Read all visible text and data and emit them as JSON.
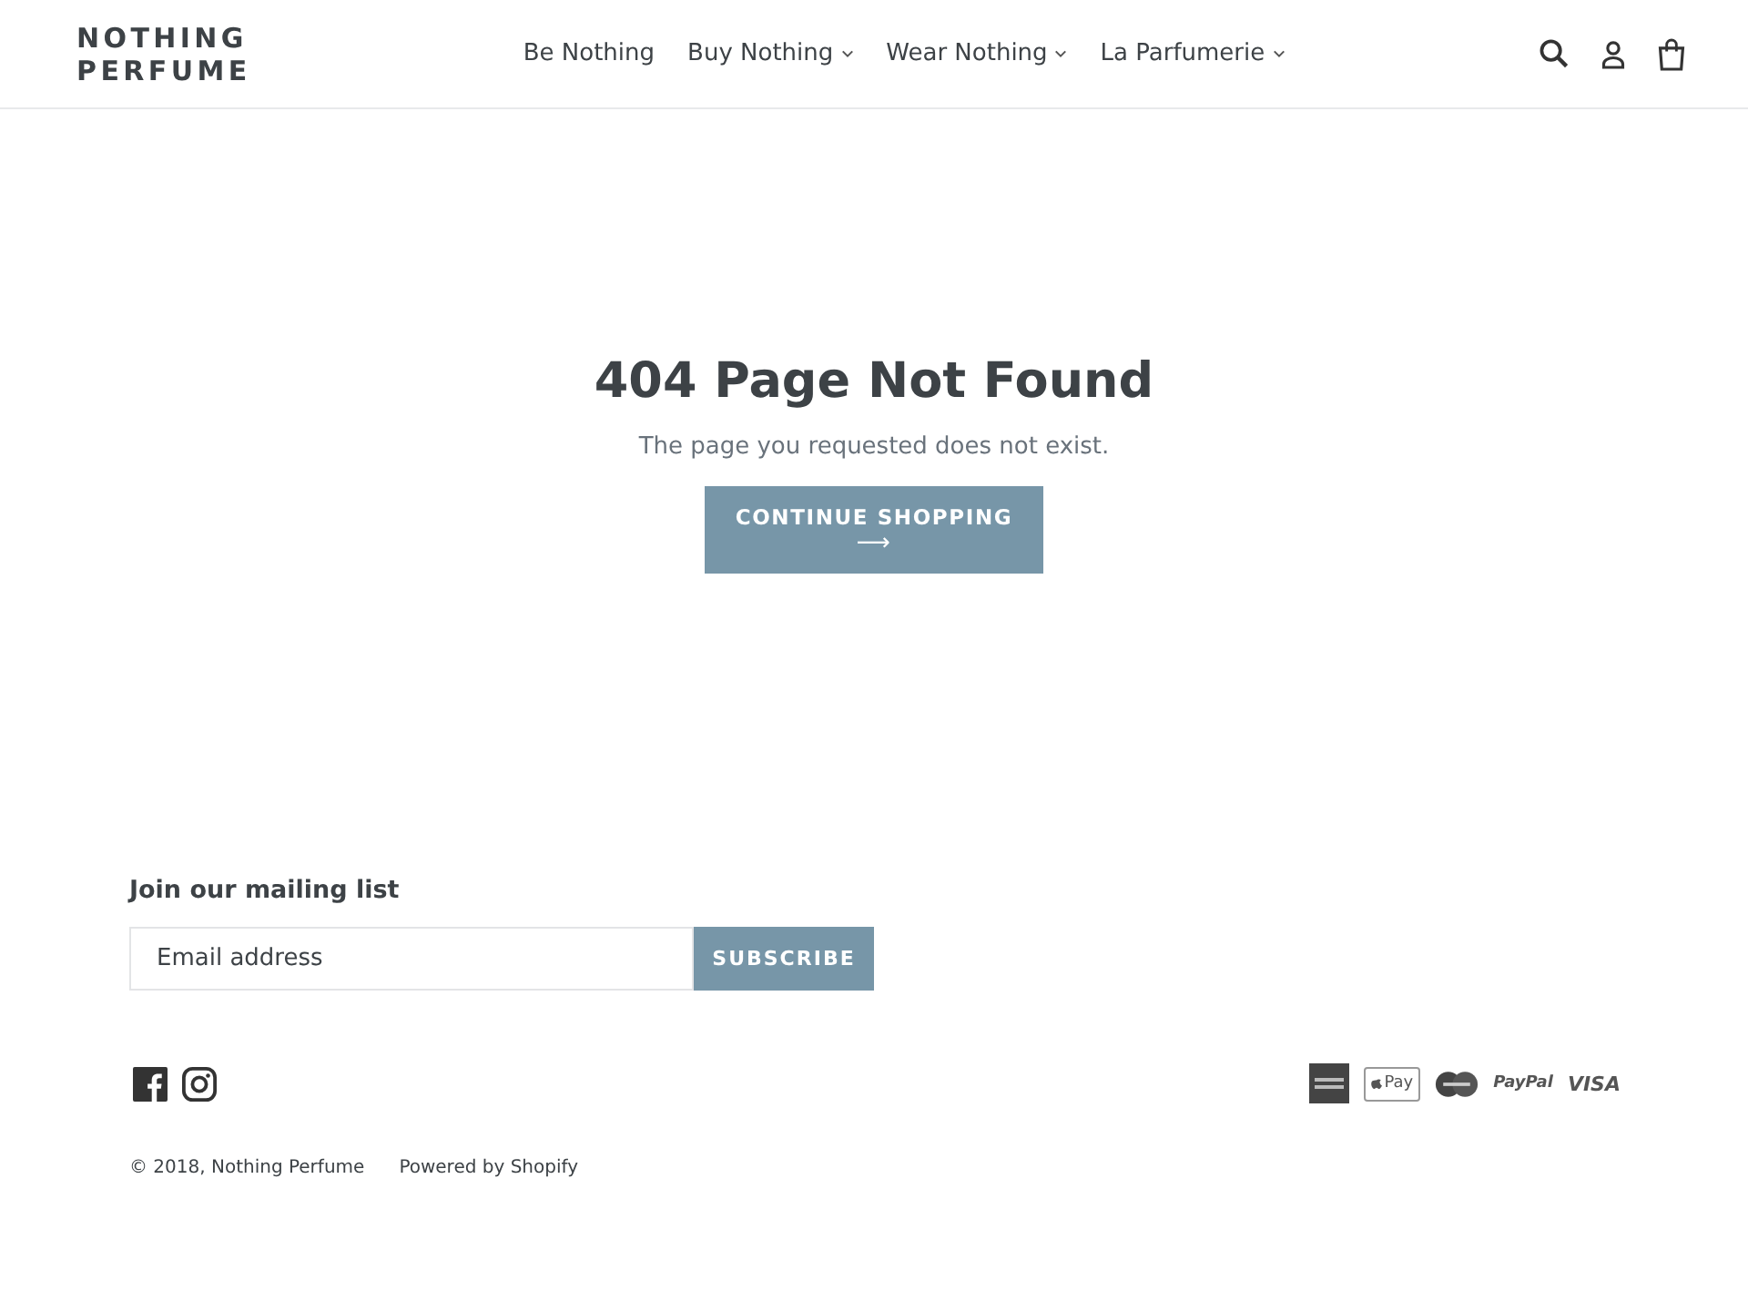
{
  "header": {
    "logo": "NOTHING PERFUME",
    "nav": [
      {
        "label": "Be Nothing",
        "has_dropdown": false
      },
      {
        "label": "Buy Nothing",
        "has_dropdown": true
      },
      {
        "label": "Wear Nothing",
        "has_dropdown": true
      },
      {
        "label": "La Parfumerie",
        "has_dropdown": true
      }
    ]
  },
  "main": {
    "title": "404 Page Not Found",
    "message": "The page you requested does not exist.",
    "button": {
      "label": "CONTINUE SHOPPING",
      "arrow": "⟶"
    }
  },
  "footer": {
    "newsletter_title": "Join our mailing list",
    "email": {
      "placeholder": "Email address"
    },
    "subscribe": "SUBSCRIBE",
    "social": [
      {
        "kind": "facebook"
      },
      {
        "kind": "instagram"
      }
    ],
    "payments": [
      {
        "kind": "amex"
      },
      {
        "kind": "applepay",
        "label": "Pay"
      },
      {
        "kind": "mastercard"
      },
      {
        "kind": "paypal",
        "label": "PayPal"
      },
      {
        "kind": "visa",
        "label": "VISA"
      }
    ],
    "copyright": "© 2018, Nothing Perfume",
    "powered": "Powered by Shopify"
  }
}
